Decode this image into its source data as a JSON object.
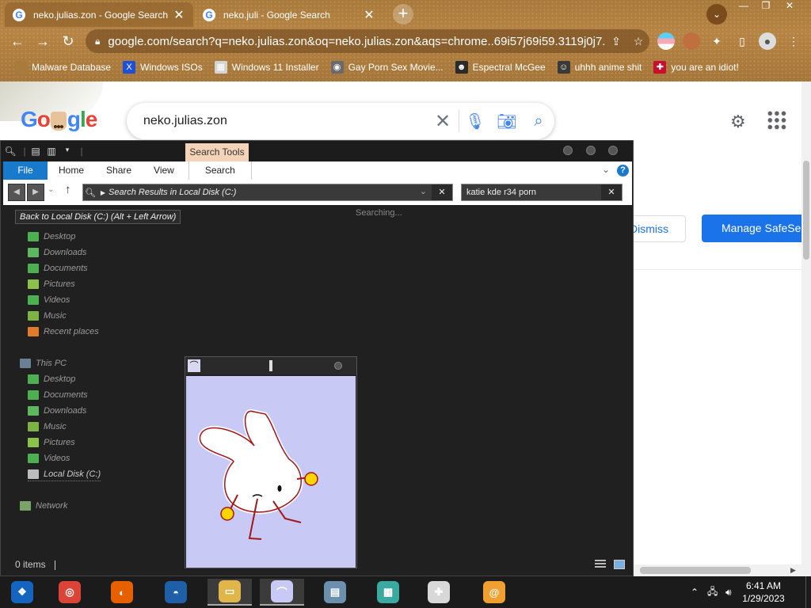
{
  "browser": {
    "tabs": [
      {
        "title": "neko.julias.zon - Google Search",
        "active": true
      },
      {
        "title": "neko.juli - Google Search",
        "active": false
      }
    ],
    "new_tab_symbol": "+",
    "tab_search_symbol": "⌄",
    "window_controls": {
      "minimize": "—",
      "restore": "❐",
      "close": "✕"
    },
    "nav": {
      "back": "←",
      "forward": "→",
      "reload": "↻"
    },
    "address_url": "google.com/search?q=neko.julias.zon&oq=neko.julias.zon&aqs=chrome..69i57j69i59.3119j0j7...",
    "bookmarks": [
      {
        "label": "Malware Database",
        "icon": "bookmark-blank-icon",
        "icon_bg": "#a87a3b",
        "glyph": ""
      },
      {
        "label": "Windows ISOs",
        "icon": "x-logo-icon",
        "icon_bg": "#1d4fd8",
        "glyph": "X"
      },
      {
        "label": "Windows 11 Installer",
        "icon": "image-icon",
        "icon_bg": "#d4d4d4",
        "glyph": "▦"
      },
      {
        "label": "Gay Porn Sex Movie...",
        "icon": "disc-icon",
        "icon_bg": "#6a6a6a",
        "glyph": "◉"
      },
      {
        "label": "Espectral McGee",
        "icon": "ghost-icon",
        "icon_bg": "#2b2b2b",
        "glyph": "☻"
      },
      {
        "label": "uhhh anime shit",
        "icon": "anime-face-icon",
        "icon_bg": "#3a3a3a",
        "glyph": "☺"
      },
      {
        "label": "you are an idiot!",
        "icon": "flag-icon",
        "icon_bg": "#c8102e",
        "glyph": "✚"
      }
    ]
  },
  "google": {
    "search_query": "neko.julias.zon",
    "dismiss_label": "Dismiss",
    "safesearch_label": "Manage SafeSearch"
  },
  "explorer": {
    "context_tab": "Search Tools",
    "ribbon_tabs": [
      "File",
      "Home",
      "Share",
      "View",
      "Search"
    ],
    "address_text": "Search Results in Local Disk (C:)",
    "search_text": "katie kde r34 porn",
    "searching_text": "Searching...",
    "tooltip": "Back to Local Disk (C:) (Alt + Left Arrow)",
    "quick_access": [
      {
        "label": "Desktop",
        "icon": "desktop-folder-icon",
        "color": "#4caf50"
      },
      {
        "label": "Downloads",
        "icon": "downloads-folder-icon",
        "color": "#5bb85d"
      },
      {
        "label": "Documents",
        "icon": "documents-folder-icon",
        "color": "#4caf50"
      },
      {
        "label": "Pictures",
        "icon": "pictures-folder-icon",
        "color": "#8bc34a"
      },
      {
        "label": "Videos",
        "icon": "videos-folder-icon",
        "color": "#4caf50"
      },
      {
        "label": "Music",
        "icon": "music-folder-icon",
        "color": "#7cb342"
      },
      {
        "label": "Recent places",
        "icon": "recent-places-icon",
        "color": "#e07b2a"
      }
    ],
    "this_pc_label": "This PC",
    "this_pc_items": [
      {
        "label": "Desktop",
        "icon": "desktop-folder-icon",
        "color": "#4caf50"
      },
      {
        "label": "Documents",
        "icon": "documents-folder-icon",
        "color": "#4caf50"
      },
      {
        "label": "Downloads",
        "icon": "downloads-folder-icon",
        "color": "#5bb85d"
      },
      {
        "label": "Music",
        "icon": "music-folder-icon",
        "color": "#7cb342"
      },
      {
        "label": "Pictures",
        "icon": "pictures-folder-icon",
        "color": "#8bc34a"
      },
      {
        "label": "Videos",
        "icon": "videos-folder-icon",
        "color": "#4caf50"
      },
      {
        "label": "Local Disk (C:)",
        "icon": "local-disk-icon",
        "color": "#bdbdbd"
      }
    ],
    "network_label": "Network",
    "status_items": "0 items"
  },
  "taskbar": {
    "apps": [
      {
        "name": "start-button",
        "icon": "windows-start-icon",
        "bg": "#1565c0",
        "glyph": "❖"
      },
      {
        "name": "chrome",
        "icon": "chrome-icon",
        "bg": "#db4437",
        "glyph": "◎"
      },
      {
        "name": "firefox",
        "icon": "firefox-icon",
        "bg": "#e66000",
        "glyph": "◐"
      },
      {
        "name": "obama",
        "icon": "obama-logo-icon",
        "bg": "#1f5fa8",
        "glyph": "◓"
      },
      {
        "name": "file-explorer",
        "icon": "folder-icon",
        "bg": "#e0b64a",
        "glyph": "▭"
      },
      {
        "name": "rabbit-app",
        "icon": "rabbit-icon",
        "bg": "#c9c9f6",
        "glyph": "⌒"
      },
      {
        "name": "system-monitor",
        "icon": "monitor-icon",
        "bg": "#6d8fae",
        "glyph": "▤"
      },
      {
        "name": "cube-app",
        "icon": "cube-icon",
        "bg": "#3aa9a0",
        "glyph": "▩"
      },
      {
        "name": "game-controller",
        "icon": "gamepad-icon",
        "bg": "#d8d8d8",
        "glyph": "✚"
      },
      {
        "name": "swirl-app",
        "icon": "swirl-icon",
        "bg": "#f0a030",
        "glyph": "@"
      }
    ],
    "time": "6:41 AM",
    "date": "1/29/2023"
  }
}
